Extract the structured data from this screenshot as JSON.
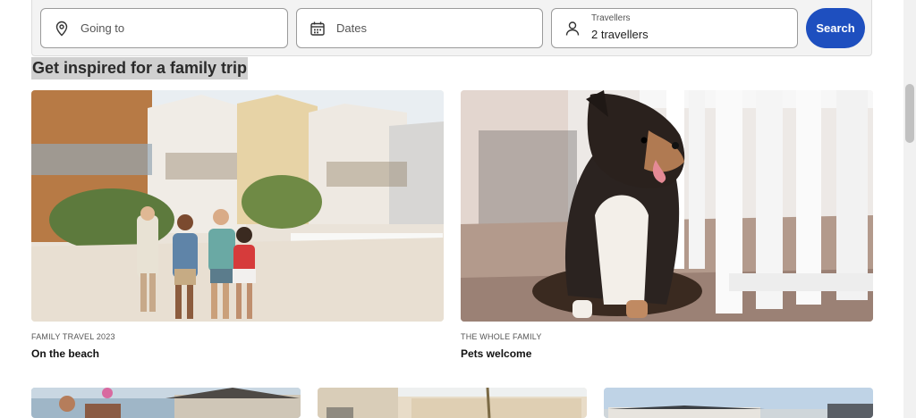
{
  "search": {
    "destination_placeholder": "Going to",
    "dates_placeholder": "Dates",
    "travellers_label": "Travellers",
    "travellers_value": "2 travellers",
    "search_button": "Search"
  },
  "section": {
    "title": "Get inspired for a family trip"
  },
  "cards": [
    {
      "kicker": "FAMILY TRAVEL 2023",
      "title": "On the beach"
    },
    {
      "kicker": "THE WHOLE FAMILY",
      "title": "Pets welcome"
    }
  ],
  "colors": {
    "accent": "#1e4fbf",
    "heading_highlight": "#d0d0d0"
  }
}
